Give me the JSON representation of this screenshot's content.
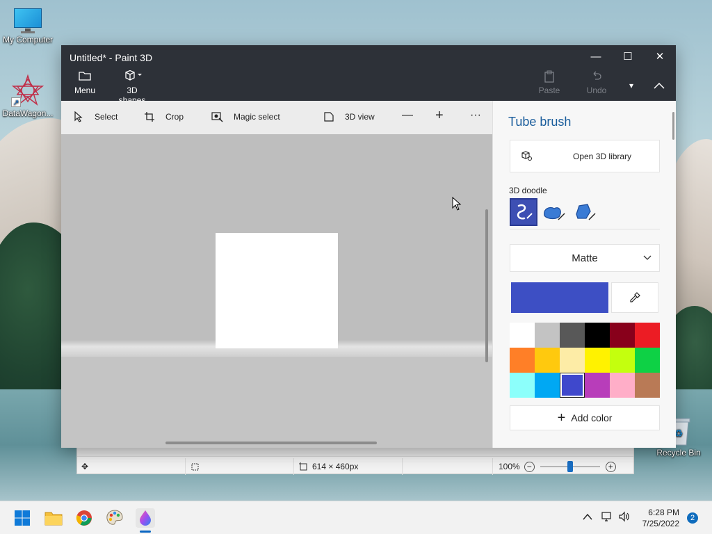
{
  "desktop": {
    "icons": [
      {
        "label": "My Computer"
      },
      {
        "label": "DataWagon..."
      },
      {
        "label": "Recycle Bin"
      }
    ]
  },
  "window": {
    "title": "Untitled* - Paint 3D",
    "controls": {
      "minimize": "—",
      "maximize": "☐",
      "close": "✕"
    },
    "top_toolbar": {
      "menu_label": "Menu",
      "shapes_label": "3D shapes",
      "paste_label": "Paste",
      "undo_label": "Undo"
    },
    "tools": {
      "select": "Select",
      "crop": "Crop",
      "magic_select": "Magic select",
      "view3d": "3D view",
      "zoom_out": "—",
      "zoom_in": "+",
      "more": "···"
    },
    "panel": {
      "title": "Tube brush",
      "open_library": "Open 3D library",
      "doodle_label": "3D doodle",
      "finish": "Matte",
      "add_color": "Add color",
      "current_color": "#3d4fc4",
      "palette": [
        "#ffffff",
        "#c3c3c3",
        "#585858",
        "#000000",
        "#88001b",
        "#ec1c24",
        "#ff7f27",
        "#ffc90e",
        "#fdeca6",
        "#fff200",
        "#c4ff0e",
        "#0ed145",
        "#8cfffb",
        "#00a8f3",
        "#3f48cc",
        "#b83dba",
        "#ffaec8",
        "#b97a56"
      ],
      "selected_index": 14
    }
  },
  "status_bar": {
    "dimensions": "614 × 460px",
    "zoom": "100%",
    "zoom_level_fraction": 0.5
  },
  "taskbar": {
    "time": "6:28 PM",
    "date": "7/25/2022",
    "notification_count": "2"
  }
}
